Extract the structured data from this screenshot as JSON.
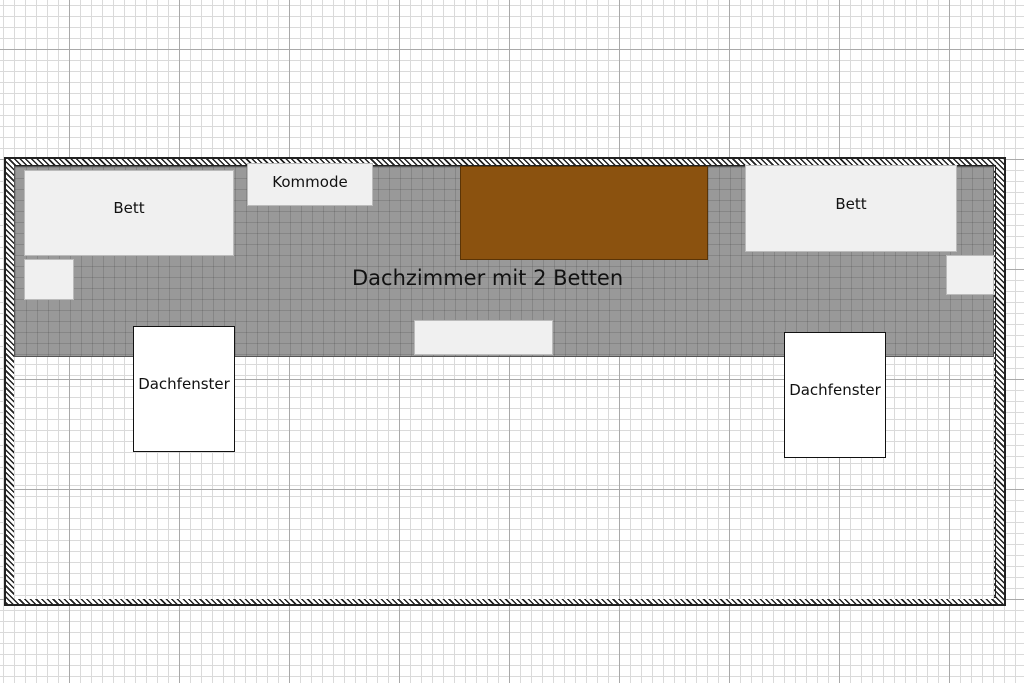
{
  "room": {
    "label": "Dachzimmer mit 2 Betten"
  },
  "furniture": {
    "bed_left": "Bett",
    "bed_right": "Bett",
    "dresser": "Kommode"
  },
  "skylights": {
    "left": "Dachfenster",
    "right": "Dachfenster"
  },
  "colors": {
    "room_floor": "#999999",
    "cabinet": "#8b520f",
    "furniture": "#f0f0f0"
  }
}
